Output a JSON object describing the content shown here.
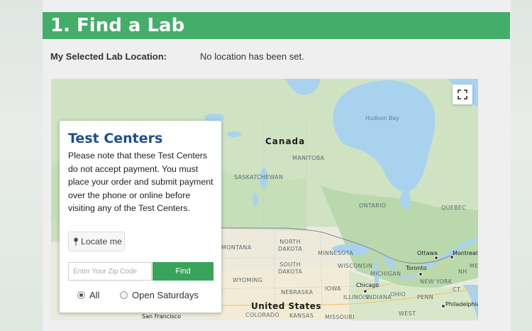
{
  "section": {
    "title": "1. Find a Lab"
  },
  "location": {
    "label": "My Selected Lab Location:",
    "value": "No location has been set."
  },
  "map": {
    "labels": {
      "canada": "Canada",
      "hudson_bay": "Hudson Bay",
      "manitoba": "MANITOBA",
      "saskatchewan": "SASKATCHEWAN",
      "ontario": "ONTARIO",
      "quebec": "QUEBEC",
      "montana": "MONTANA",
      "north_dakota": "NORTH\nDAKOTA",
      "south_dakota": "SOUTH\nDAKOTA",
      "minnesota": "MINNESOTA",
      "wisconsin": "WISCONSIN",
      "michigan": "MICHIGAN",
      "wyoming": "WYOMING",
      "nebraska": "NEBRASKA",
      "iowa": "IOWA",
      "illinois": "ILLINOIS",
      "indiana": "INDIANA",
      "ohio": "OHIO",
      "new_york": "NEW YORK",
      "united_states": "United States",
      "kansas": "KANSAS",
      "colorado": "COLORADO",
      "missouri": "MISSOURI",
      "west": "WEST",
      "penn": "PENN",
      "ct": "CT",
      "nh": "NH",
      "me": "ME",
      "ottawa": "Ottawa",
      "montreal": "Montreal",
      "toronto": "Toronto",
      "chicago": "Chicago",
      "philadelphia": "Philadelphia",
      "san_francisco": "San Francisco"
    }
  },
  "panel": {
    "title": "Test Centers",
    "notice": "Please note that these Test Centers do not accept payment. You must place your order and submit payment over the phone or online before visiting any of the Test Centers.",
    "locate_label": "Locate me",
    "zip_placeholder": "Enter Your Zip Code",
    "find_label": "Find",
    "filters": [
      {
        "label": "All",
        "selected": true
      },
      {
        "label": "Open Saturdays",
        "selected": false
      }
    ]
  },
  "colors": {
    "header_green": "#45ad6a",
    "button_green": "#3aa35b",
    "title_blue": "#1f4f8a",
    "water": "#a9d2ee"
  }
}
